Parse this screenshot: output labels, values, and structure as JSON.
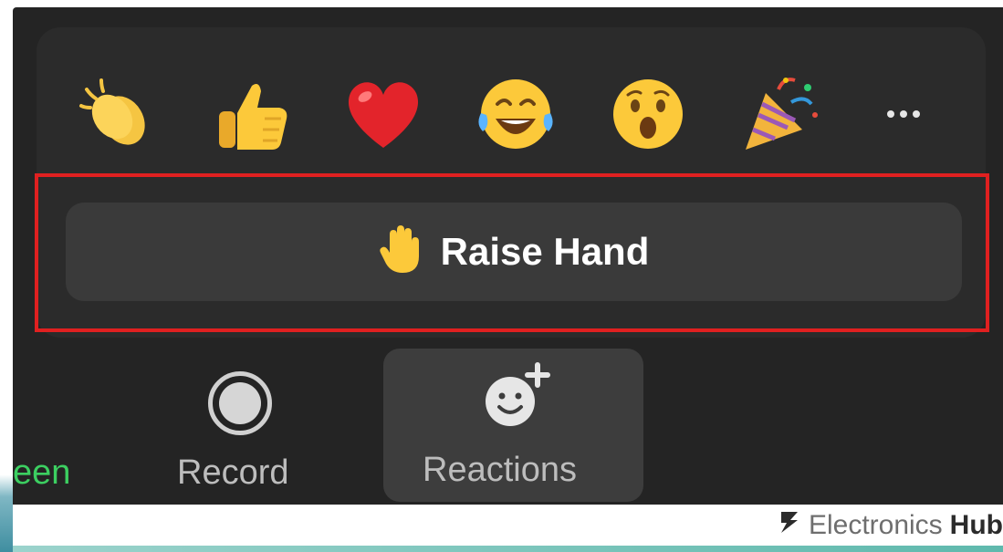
{
  "reactions": {
    "emojis": [
      {
        "name": "clapping-hands"
      },
      {
        "name": "thumbs-up"
      },
      {
        "name": "red-heart"
      },
      {
        "name": "tears-of-joy"
      },
      {
        "name": "open-mouth"
      },
      {
        "name": "party-popper"
      }
    ],
    "more_icon": "ellipsis-icon",
    "raise_hand": {
      "icon": "raised-hand",
      "label": "Raise Hand"
    }
  },
  "toolbar": {
    "share_partial_label": "een",
    "record_label": "Record",
    "reactions_label": "Reactions"
  },
  "watermark": {
    "name_light": "Electronics",
    "name_bold": "Hub"
  },
  "colors": {
    "toolbar_bg": "#242424",
    "highlight": "#e02020",
    "share_green": "#3ccf61"
  }
}
